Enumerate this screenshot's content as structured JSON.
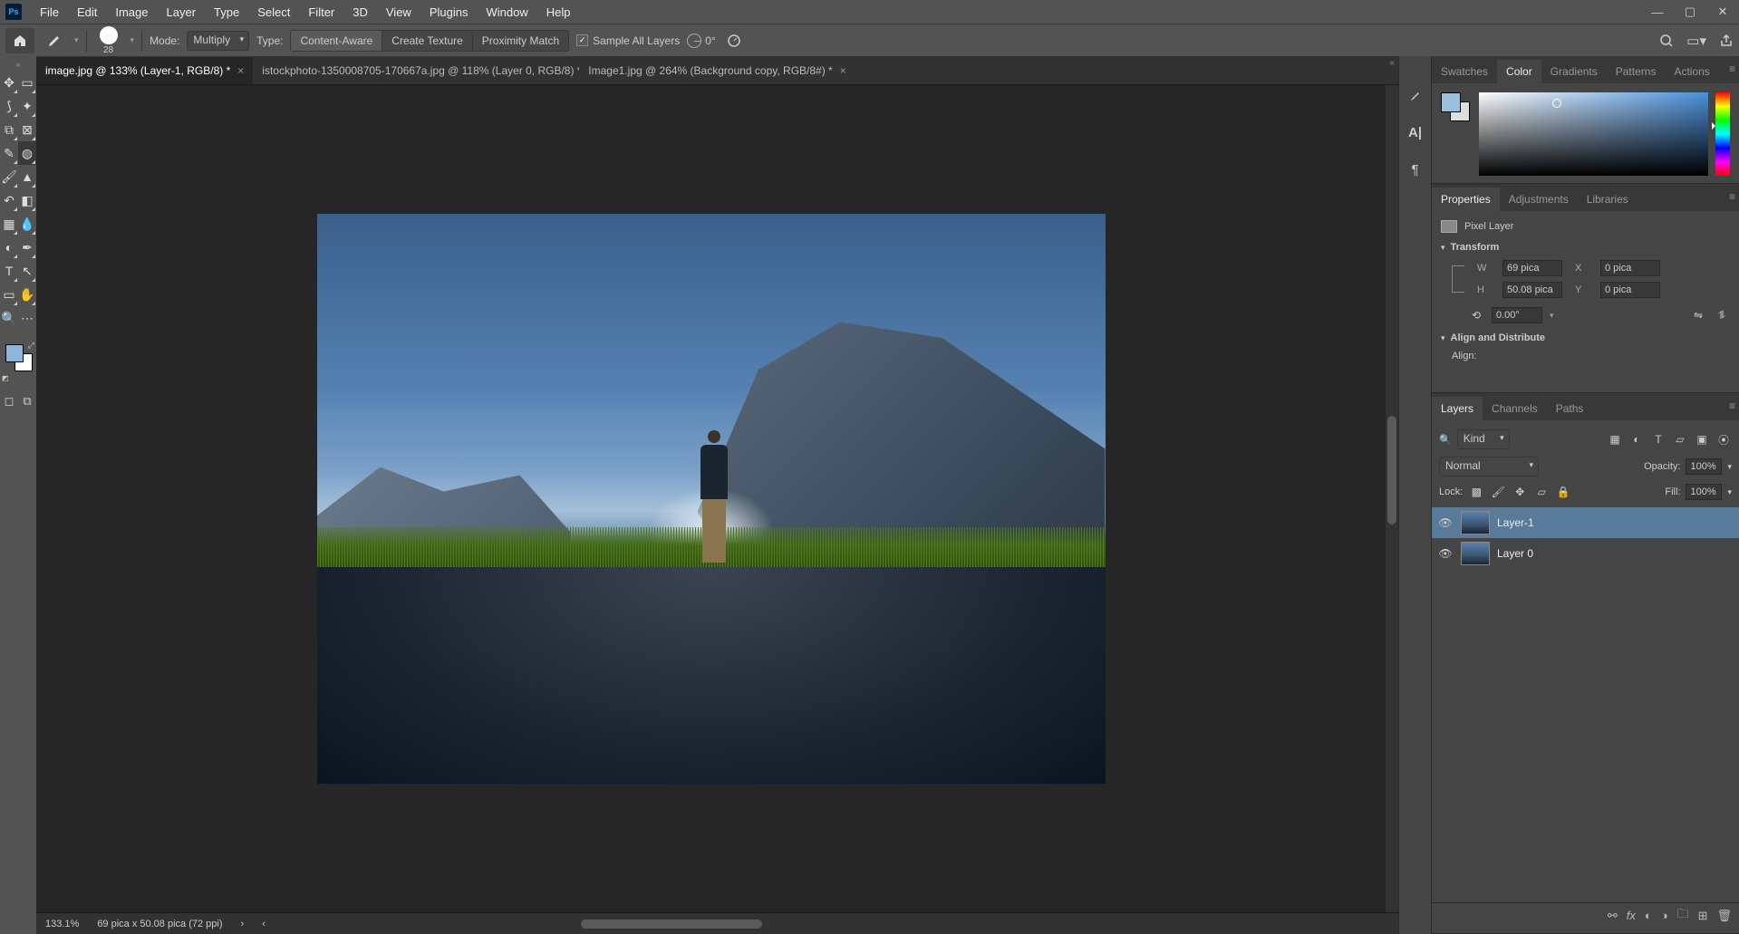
{
  "menubar": [
    "File",
    "Edit",
    "Image",
    "Layer",
    "Type",
    "Select",
    "Filter",
    "3D",
    "View",
    "Plugins",
    "Window",
    "Help"
  ],
  "optionsBar": {
    "brushSize": "28",
    "modeLabel": "Mode:",
    "modeValue": "Multiply",
    "typeLabel": "Type:",
    "typeButtons": [
      "Content-Aware",
      "Create Texture",
      "Proximity Match"
    ],
    "activeType": 0,
    "sampleLabel": "Sample All Layers",
    "angleValue": "0°"
  },
  "tabs": [
    {
      "label": "Image1.jpg @ 264% (Background copy, RGB/8#) *",
      "active": false
    },
    {
      "label": "istockphoto-1350008705-170667a.jpg @ 118% (Layer 0, RGB/8) *",
      "active": false
    },
    {
      "label": "image.jpg @ 133% (Layer-1, RGB/8) *",
      "active": true
    }
  ],
  "statusBar": {
    "zoom": "133.1%",
    "docInfo": "69 pica x 50.08 pica (72 ppi)"
  },
  "colorTabs": [
    "Swatches",
    "Color",
    "Gradients",
    "Patterns",
    "Actions"
  ],
  "colorActive": 1,
  "propsTabs": [
    "Properties",
    "Adjustments",
    "Libraries"
  ],
  "propsActive": 0,
  "properties": {
    "layerType": "Pixel Layer",
    "transformLabel": "Transform",
    "W": "69 pica",
    "H": "50.08 pica",
    "X": "0 pica",
    "Y": "0 pica",
    "angle": "0.00°",
    "alignLabel": "Align and Distribute",
    "alignText": "Align:"
  },
  "layersTabs": [
    "Layers",
    "Channels",
    "Paths"
  ],
  "layersActive": 0,
  "layersPanel": {
    "filterValue": "Kind",
    "blendMode": "Normal",
    "opacityLabel": "Opacity:",
    "opacityValue": "100%",
    "lockLabel": "Lock:",
    "fillLabel": "Fill:",
    "fillValue": "100%",
    "layers": [
      {
        "name": "Layer-1",
        "selected": true,
        "visible": true
      },
      {
        "name": "Layer 0",
        "selected": false,
        "visible": true
      }
    ]
  },
  "colors": {
    "fg": "#8eb5dd",
    "bg": "#ffffff"
  }
}
